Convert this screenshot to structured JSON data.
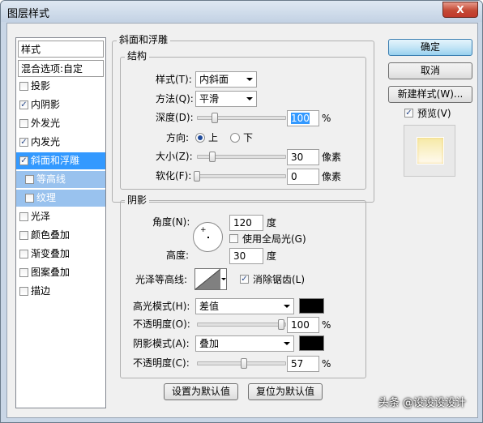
{
  "window": {
    "title": "图层样式",
    "close_label": "X"
  },
  "style_list": {
    "header": "样式",
    "blending": "混合选项:自定",
    "items": [
      {
        "label": "投影",
        "checked": false
      },
      {
        "label": "内阴影",
        "checked": true
      },
      {
        "label": "外发光",
        "checked": false
      },
      {
        "label": "内发光",
        "checked": true
      },
      {
        "label": "斜面和浮雕",
        "checked": true,
        "selected": true
      },
      {
        "label": "等高线",
        "checked": false,
        "sub": true
      },
      {
        "label": "纹理",
        "checked": false,
        "sub": true
      },
      {
        "label": "光泽",
        "checked": false
      },
      {
        "label": "颜色叠加",
        "checked": false
      },
      {
        "label": "渐变叠加",
        "checked": false
      },
      {
        "label": "图案叠加",
        "checked": false
      },
      {
        "label": "描边",
        "checked": false
      }
    ]
  },
  "bevel": {
    "title": "斜面和浮雕",
    "structure_title": "结构",
    "style_label": "样式(T):",
    "style_value": "内斜面",
    "technique_label": "方法(Q):",
    "technique_value": "平滑",
    "depth_label": "深度(D):",
    "depth_value": "100",
    "depth_unit": "%",
    "direction_label": "方向:",
    "direction_up": "上",
    "direction_down": "下",
    "direction_selected": "上",
    "size_label": "大小(Z):",
    "size_value": "30",
    "size_unit": "像素",
    "soften_label": "软化(F):",
    "soften_value": "0",
    "soften_unit": "像素"
  },
  "shading": {
    "title": "阴影",
    "angle_label": "角度(N):",
    "angle_value": "120",
    "angle_unit": "度",
    "global_light_label": "使用全局光(G)",
    "global_light_checked": false,
    "altitude_label": "高度:",
    "altitude_value": "30",
    "altitude_unit": "度",
    "gloss_contour_label": "光泽等高线:",
    "antialias_label": "消除锯齿(L)",
    "antialias_checked": true,
    "highlight_mode_label": "高光模式(H):",
    "highlight_mode_value": "差值",
    "highlight_color": "#000000",
    "highlight_opacity_label": "不透明度(O):",
    "highlight_opacity_value": "100",
    "highlight_opacity_unit": "%",
    "shadow_mode_label": "阴影模式(A):",
    "shadow_mode_value": "叠加",
    "shadow_color": "#000000",
    "shadow_opacity_label": "不透明度(C):",
    "shadow_opacity_value": "57",
    "shadow_opacity_unit": "%"
  },
  "buttons": {
    "set_default": "设置为默认值",
    "reset_default": "复位为默认值",
    "ok": "确定",
    "cancel": "取消",
    "new_style": "新建样式(W)...",
    "preview": "预览(V)",
    "preview_checked": true
  },
  "watermark": "头条 @设设设设计"
}
